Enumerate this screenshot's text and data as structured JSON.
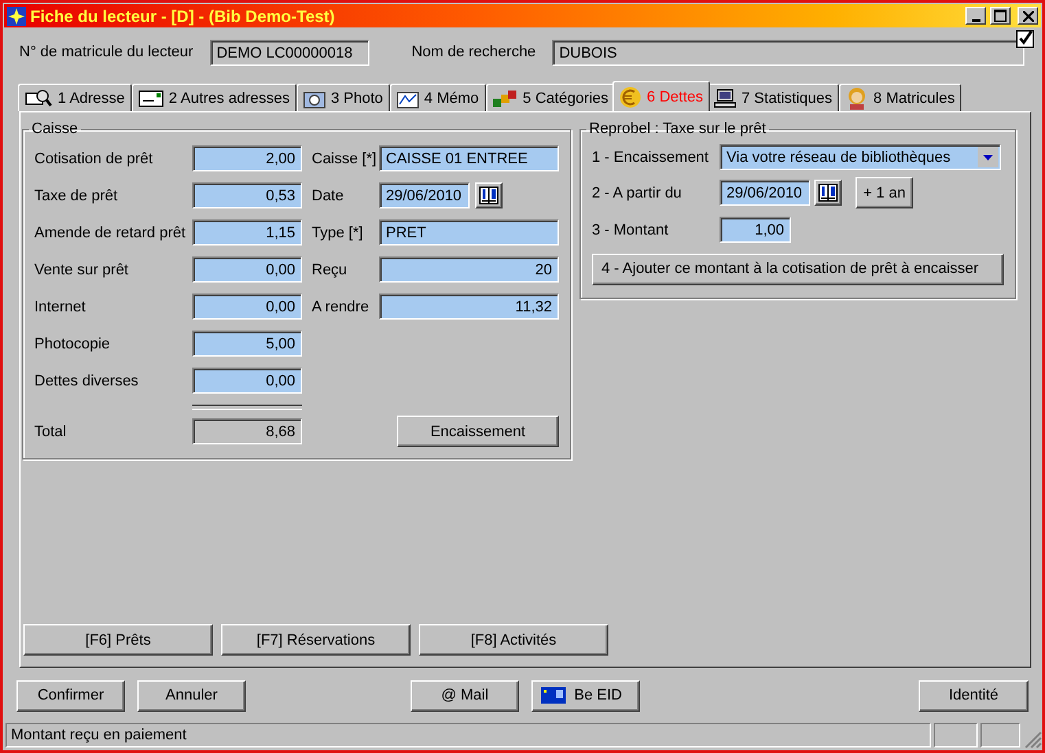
{
  "window": {
    "title": "Fiche du lecteur - [D] - (Bib Demo-Test)"
  },
  "header": {
    "matricule_label": "N° de matricule du lecteur",
    "matricule_value": "DEMO LC00000018",
    "nom_label": "Nom de recherche",
    "nom_value": "DUBOIS",
    "checked": true
  },
  "tabs": [
    {
      "label": "1 Adresse",
      "selected": false
    },
    {
      "label": "2 Autres adresses",
      "selected": false
    },
    {
      "label": "3 Photo",
      "selected": false
    },
    {
      "label": "4 Mémo",
      "selected": false
    },
    {
      "label": "5 Catégories",
      "selected": false
    },
    {
      "label": "6 Dettes",
      "selected": true
    },
    {
      "label": "7 Statistiques",
      "selected": false
    },
    {
      "label": "8 Matricules",
      "selected": false
    }
  ],
  "caisse": {
    "title": "Caisse",
    "amounts": [
      {
        "label": "Cotisation de prêt",
        "value": "2,00"
      },
      {
        "label": "Taxe de prêt",
        "value": "0,53"
      },
      {
        "label": "Amende de retard prêt",
        "value": "1,15"
      },
      {
        "label": "Vente sur prêt",
        "value": "0,00"
      },
      {
        "label": "Internet",
        "value": "0,00"
      },
      {
        "label": "Photocopie",
        "value": "5,00"
      },
      {
        "label": "Dettes diverses",
        "value": "0,00"
      }
    ],
    "total": {
      "label": "Total",
      "value": "8,68"
    },
    "details": [
      {
        "label": "Caisse [*]",
        "value": "CAISSE 01 ENTREE",
        "kind": "text"
      },
      {
        "label": "Date",
        "value": "29/06/2010",
        "kind": "date"
      },
      {
        "label": "Type [*]",
        "value": "PRET",
        "kind": "text"
      },
      {
        "label": "Reçu",
        "value": "20",
        "kind": "number"
      },
      {
        "label": "A rendre",
        "value": "11,32",
        "kind": "number"
      }
    ],
    "button": "Encaissement"
  },
  "reprobel": {
    "title": "Reprobel : Taxe sur le prêt",
    "encaissement": {
      "label": "1 - Encaissement",
      "value": "Via votre réseau de bibliothèques"
    },
    "date": {
      "label": "2 - A partir du",
      "value": "29/06/2010"
    },
    "plus_button": "+ 1 an",
    "montant": {
      "label": "3 - Montant",
      "value": "1,00"
    },
    "add_button": "4 - Ajouter ce montant à la cotisation de prêt à encaisser"
  },
  "panel_buttons": [
    "[F6] Prêts",
    "[F7] Réservations",
    "[F8] Activités"
  ],
  "footer": {
    "left": [
      "Confirmer",
      "Annuler"
    ],
    "mail": "@ Mail",
    "eid": "Be EID",
    "right": "Identité"
  },
  "status_bar": {
    "text": "Montant reçu en paiement"
  }
}
